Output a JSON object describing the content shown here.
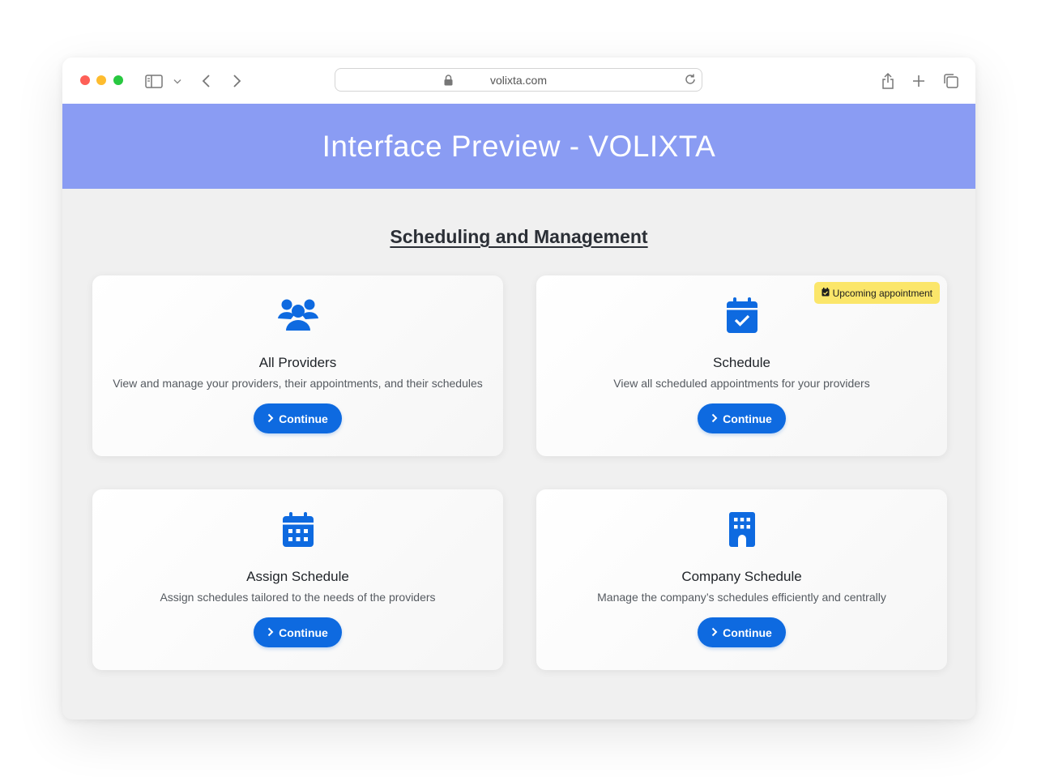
{
  "browser": {
    "url": "volixta.com",
    "traffic_lights": {
      "close": "#fe5f57",
      "minimize": "#febc2e",
      "zoom": "#28c840"
    }
  },
  "header": {
    "title": "Interface Preview - VOLIXTA",
    "background": "#8a9cf3"
  },
  "section": {
    "title": "Scheduling and Management"
  },
  "accent_color": "#0e6ae0",
  "cards": [
    {
      "icon": "users-icon",
      "title": "All Providers",
      "description": "View and manage your providers, their appointments, and their schedules",
      "button": "Continue"
    },
    {
      "icon": "calendar-check-icon",
      "title": "Schedule",
      "description": "View all scheduled appointments for your providers",
      "button": "Continue",
      "badge": "Upcoming appointment"
    },
    {
      "icon": "calendar-grid-icon",
      "title": "Assign Schedule",
      "description": "Assign schedules tailored to the needs of the providers",
      "button": "Continue"
    },
    {
      "icon": "building-icon",
      "title": "Company Schedule",
      "description": "Manage the company’s schedules efficiently and centrally",
      "button": "Continue"
    }
  ]
}
